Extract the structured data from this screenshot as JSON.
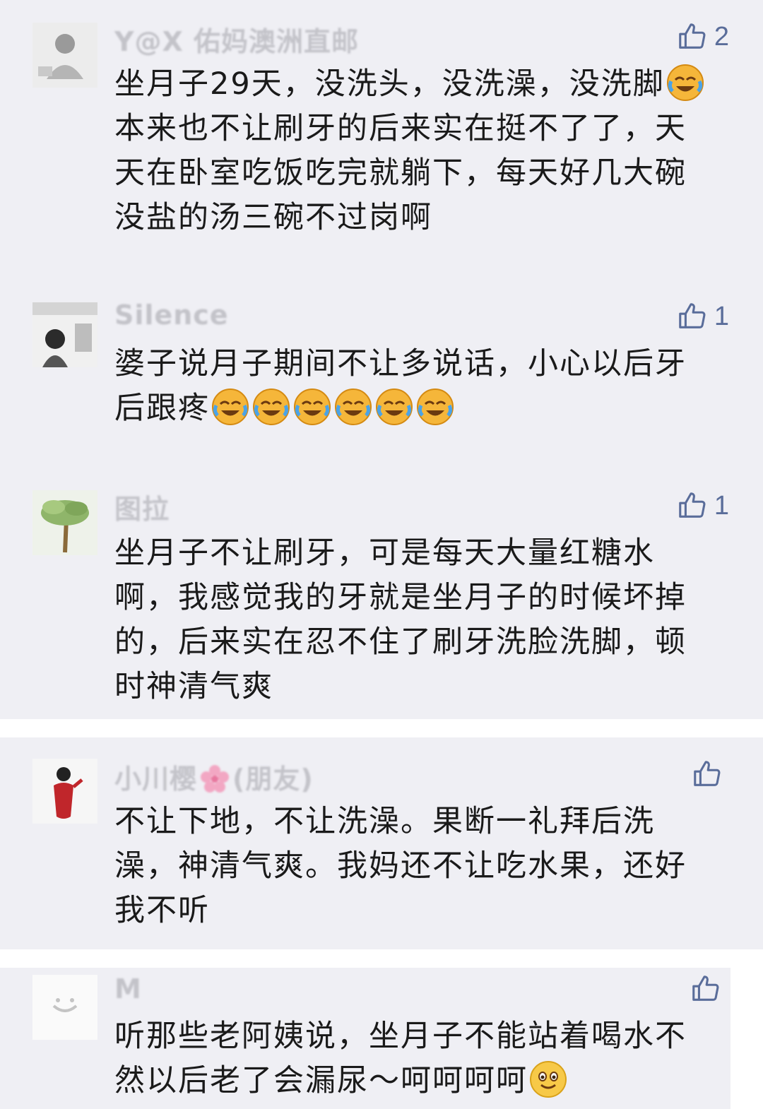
{
  "comments": [
    {
      "user": "Y@X 佑妈澳洲直邮",
      "likes": "2",
      "text_before": "坐月子29天，没洗头，没洗澡，没洗脚",
      "text_after": "本来也不让刷牙的后来实在挺不了了，天天在卧室吃饭吃完就躺下，每天好几大碗没盐的汤三碗不过岗啊"
    },
    {
      "user": "Silence",
      "likes": "1",
      "text": "婆子说月子期间不让多说话，小心以后牙后跟疼"
    },
    {
      "user": "图拉",
      "likes": "1",
      "text": "坐月子不让刷牙，可是每天大量红糖水啊，我感觉我的牙就是坐月子的时候坏掉的，后来实在忍不住了刷牙洗脸洗脚，顿时神清气爽"
    },
    {
      "user_before": "小川樱",
      "user_after": "(朋友)",
      "likes": "",
      "text": "不让下地，不让洗澡。果断一礼拜后洗澡，神清气爽。我妈还不让吃水果，还好我不听"
    },
    {
      "user": "M",
      "likes": "",
      "text": "听那些老阿姨说，坐月子不能站着喝水不然以后老了会漏尿～呵呵呵呵"
    }
  ],
  "icons": {
    "like": "thumbs-up-outline-icon",
    "cry_laugh": "face-with-tears-of-joy-icon",
    "smile": "smiling-face-icon",
    "flower": "cherry-blossom-icon"
  },
  "colors": {
    "panel_bg": "#efeff4",
    "name_text": "#c3c3c9",
    "like_icon": "#5a6d9a",
    "body_text": "#1a1a1a"
  }
}
